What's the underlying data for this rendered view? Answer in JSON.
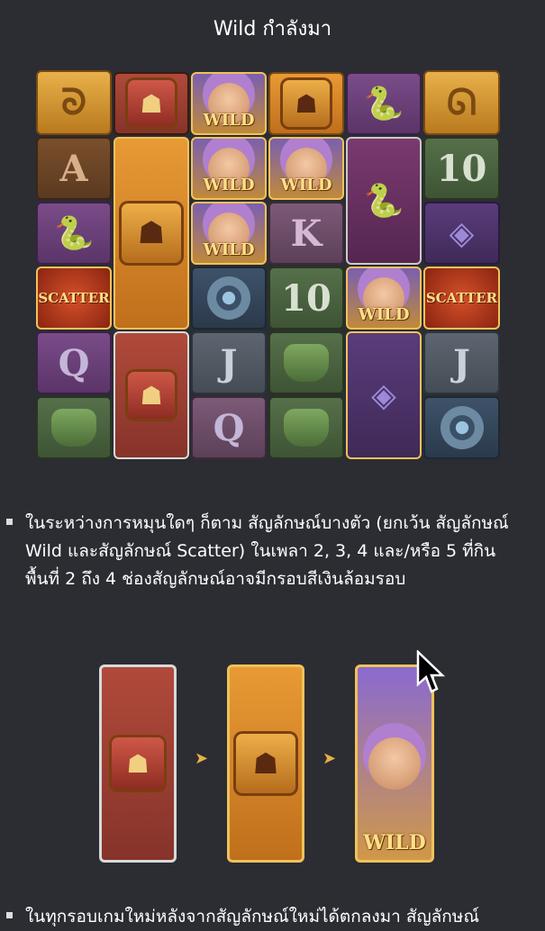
{
  "title": "Wild กำลังมา",
  "grid": {
    "wild_label": "WILD",
    "scatter_label": "SCATTER",
    "letters": {
      "A": "A",
      "K": "K",
      "Q": "Q",
      "J": "J",
      "ten": "10"
    }
  },
  "description": "ในระหว่างการหมุนใดๆ ก็ตาม สัญลักษณ์บางตัว (ยกเว้น สัญลักษณ์ Wild และสัญลักษณ์ Scatter) ในเพลา 2, 3, 4 และ/หรือ 5 ที่กินพื้นที่ 2 ถึง 4 ช่องสัญลักษณ์อาจมีกรอบสีเงินล้อมรอบ",
  "next_paragraph": "ในทุกรอบเกมใหม่หลังจากสัญลักษณ์ใหม่ได้ตกลงมา สัญลักษณ์",
  "sequence": {
    "arrow": "➤",
    "wild_label": "WILD"
  },
  "colors": {
    "background": "#2b2d33",
    "accent_gold": "#e8b04a"
  }
}
